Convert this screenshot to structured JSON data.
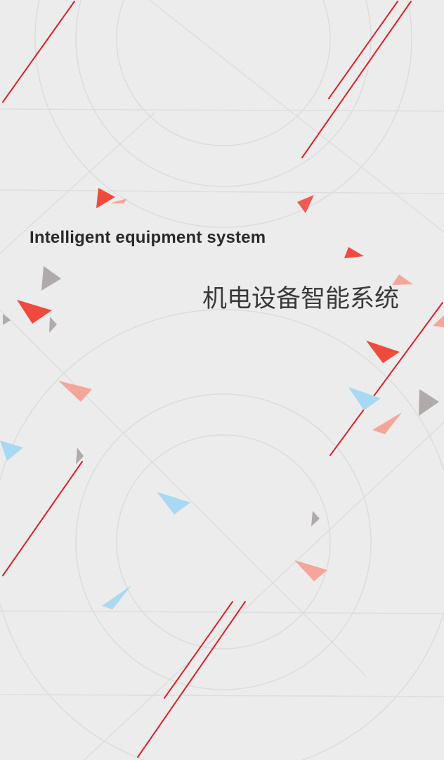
{
  "headline": {
    "english": "Intelligent equipment system",
    "chinese": "机电设备智能系统"
  },
  "colors": {
    "background": "#ececec",
    "line_red": "#d9222a",
    "guide_gray": "#d9d9d9",
    "triangle_red": "#f04a3c",
    "triangle_pink": "#f5a59a",
    "triangle_blue": "#a9d8f2",
    "triangle_gray": "#b0aaaa"
  }
}
